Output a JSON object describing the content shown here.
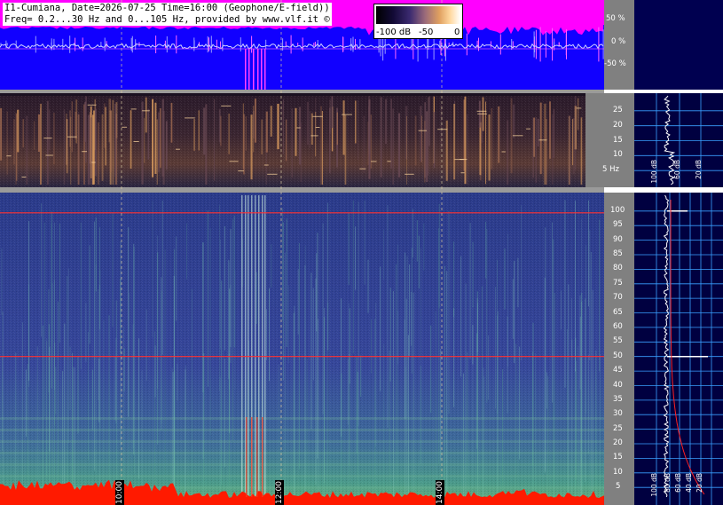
{
  "header": {
    "line1": "I1-Cumiana, Date=2026-07-25 Time=16:00 (Geophone/E-field))",
    "line2": "Freq= 0.2...30 Hz and 0...105 Hz, provided by www.vlf.it ©"
  },
  "colorbar": {
    "labels": [
      "-100 dB",
      "-50",
      "0"
    ]
  },
  "colors": {
    "wave_bg": "#1100ff",
    "wave_fill": "#ff00ff",
    "axis_bg": "#808080",
    "right_bg": "#000040",
    "grid": "#3aa0ff",
    "marker": "#d8c8a0"
  },
  "chart_data": [
    {
      "type": "area",
      "description_key": "waveform",
      "ylabel_ticks": [
        "50 %",
        "0 %",
        "-50 %"
      ],
      "ylim": [
        -100,
        100
      ],
      "time_markers": [
        "10:00",
        "12:00",
        "14:00"
      ]
    },
    {
      "type": "heatmap",
      "description_key": "spectrogram_low",
      "yticks": [
        "25",
        "20",
        "15",
        "10",
        "5 Hz"
      ],
      "ylim": [
        0.2,
        30
      ],
      "spectrum_xticks": [
        "100 dB",
        "60 dB",
        "20 dB"
      ]
    },
    {
      "type": "heatmap",
      "description_key": "spectrogram_high",
      "yticks": [
        "100",
        "95",
        "90",
        "85",
        "80",
        "75",
        "70",
        "65",
        "60",
        "55",
        "50",
        "45",
        "40",
        "35",
        "30",
        "25",
        "20",
        "15",
        "10",
        "5"
      ],
      "ylim": [
        0,
        105
      ],
      "time_labels": [
        "10:00",
        "12:00",
        "14:00"
      ],
      "spectrum_xticks": [
        "100 dB",
        "80 dB",
        "60 dB",
        "40 dB",
        "20 dB"
      ],
      "lines_hz": [
        50,
        100
      ]
    }
  ]
}
